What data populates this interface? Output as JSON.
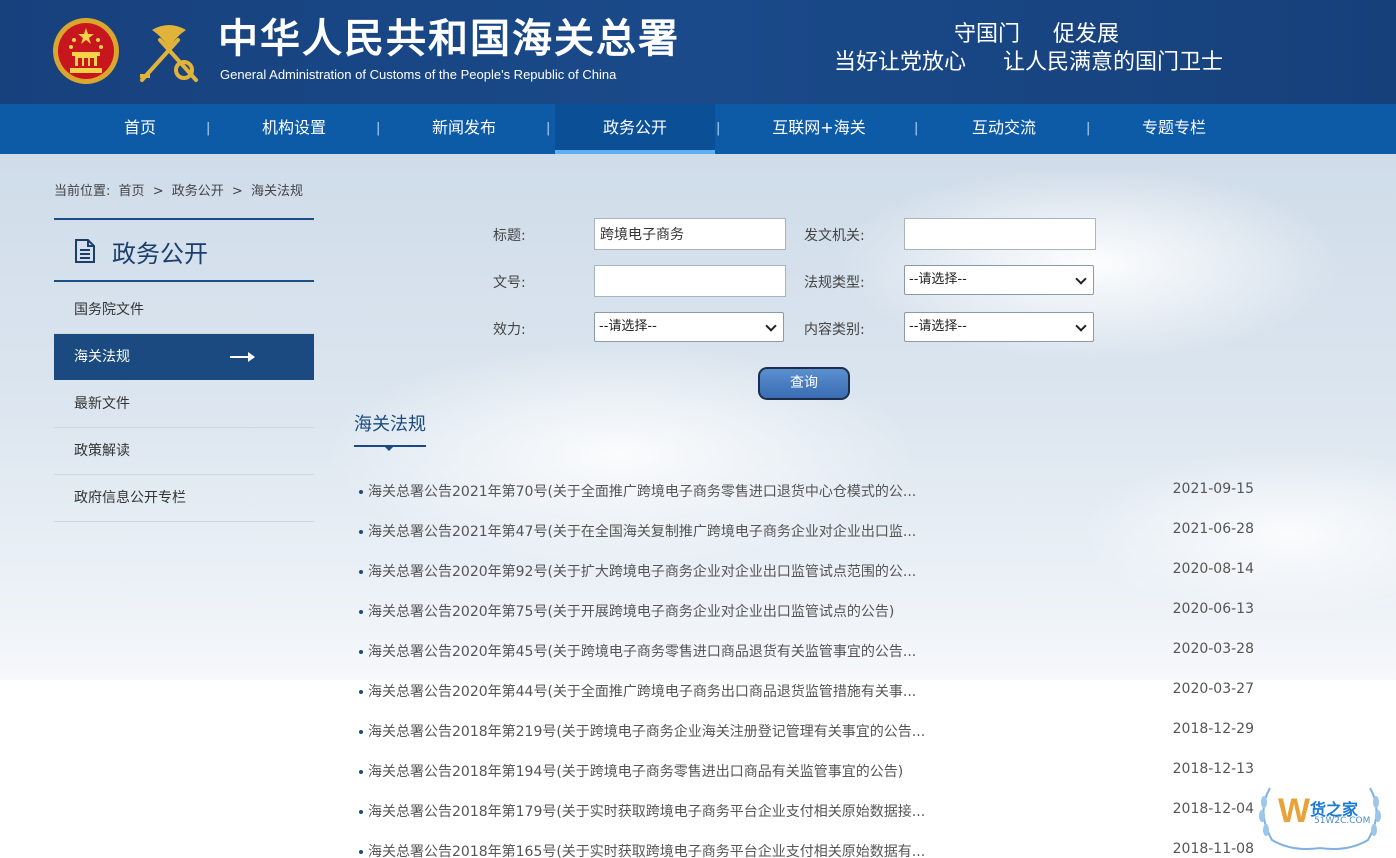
{
  "header": {
    "title": "中华人民共和国海关总署",
    "subtitle": "General Administration of Customs of the People's Republic of China",
    "slogan_line1": "守国门 促发展",
    "slogan_line2": "当好让党放心 让人民满意的国门卫士"
  },
  "nav": {
    "items": [
      {
        "label": "首页"
      },
      {
        "label": "机构设置"
      },
      {
        "label": "新闻发布"
      },
      {
        "label": "政务公开"
      },
      {
        "label": "互联网+海关"
      },
      {
        "label": "互动交流"
      },
      {
        "label": "专题专栏"
      }
    ],
    "active": "政务公开"
  },
  "breadcrumb": {
    "prefix": "当前位置:",
    "items": [
      "首页",
      ">",
      "政务公开",
      ">",
      "海关法规"
    ]
  },
  "sidebar": {
    "title": "政务公开",
    "items": [
      {
        "label": "国务院文件"
      },
      {
        "label": "海关法规"
      },
      {
        "label": "最新文件"
      },
      {
        "label": "政策解读"
      },
      {
        "label": "政府信息公开专栏"
      }
    ],
    "active": "海关法规"
  },
  "search": {
    "title_label": "标题:",
    "title_value": "跨境电子商务",
    "issuer_label": "发文机关:",
    "issuer_value": "",
    "docno_label": "文号:",
    "docno_value": "",
    "law_type_label": "法规类型:",
    "law_type_value": "--请选择--",
    "validity_label": "效力:",
    "validity_value": "--请选择--",
    "content_type_label": "内容类别:",
    "content_type_value": "--请选择--",
    "submit_label": "查询"
  },
  "list": {
    "section_title": "海关法规",
    "rows": [
      {
        "title": "海关总署公告2021年第70号(关于全面推广跨境电子商务零售进口退货中心仓模式的公...",
        "date": "2021-09-15"
      },
      {
        "title": "海关总署公告2021年第47号(关于在全国海关复制推广跨境电子商务企业对企业出口监...",
        "date": "2021-06-28"
      },
      {
        "title": "海关总署公告2020年第92号(关于扩大跨境电子商务企业对企业出口监管试点范围的公...",
        "date": "2020-08-14"
      },
      {
        "title": "海关总署公告2020年第75号(关于开展跨境电子商务企业对企业出口监管试点的公告)",
        "date": "2020-06-13"
      },
      {
        "title": "海关总署公告2020年第45号(关于跨境电子商务零售进口商品退货有关监管事宜的公告...",
        "date": "2020-03-28"
      },
      {
        "title": "海关总署公告2020年第44号(关于全面推广跨境电子商务出口商品退货监管措施有关事...",
        "date": "2020-03-27"
      },
      {
        "title": "海关总署公告2018年第219号(关于跨境电子商务企业海关注册登记管理有关事宜的公告...",
        "date": "2018-12-29"
      },
      {
        "title": "海关总署公告2018年第194号(关于跨境电子商务零售进出口商品有关监管事宜的公告)",
        "date": "2018-12-13"
      },
      {
        "title": "海关总署公告2018年第179号(关于实时获取跨境电子商务平台企业支付相关原始数据接...",
        "date": "2018-12-04"
      },
      {
        "title": "海关总署公告2018年第165号(关于实时获取跨境电子商务平台企业支付相关原始数据有...",
        "date": "2018-11-08"
      }
    ]
  },
  "watermark": {
    "brand": "货之家",
    "url": "51W2C.COM",
    "letter": "W"
  },
  "colors": {
    "header_bg": "#17417d",
    "nav_bg": "#0d5aa7",
    "accent": "#1b4a80",
    "active_underline": "#5eb0ee"
  }
}
